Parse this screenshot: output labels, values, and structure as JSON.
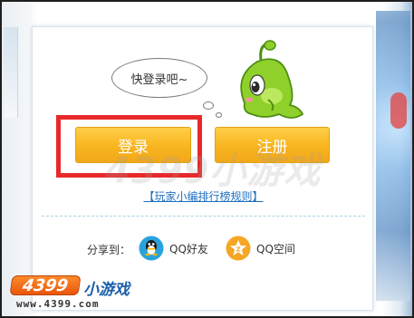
{
  "dialog": {
    "bubble_text": "快登录吧~",
    "login_label": "登录",
    "register_label": "注册",
    "rules_link": "【玩家小编排行榜规则】",
    "share": {
      "label": "分享到：",
      "qq_label": "QQ好友",
      "qzone_label": "QQ空间"
    }
  },
  "watermark": "4399小游戏",
  "brand": {
    "badge": "4399",
    "title": "小游戏",
    "url": "www.4399.com"
  },
  "colors": {
    "button": "#f8b420",
    "highlight": "#e8292a",
    "link": "#1f6fbf",
    "mascot": "#8fd12a"
  },
  "icons": {
    "mascot": "green-creature-icon",
    "qq": "qq-penguin-icon",
    "qzone": "qzone-star-icon"
  }
}
